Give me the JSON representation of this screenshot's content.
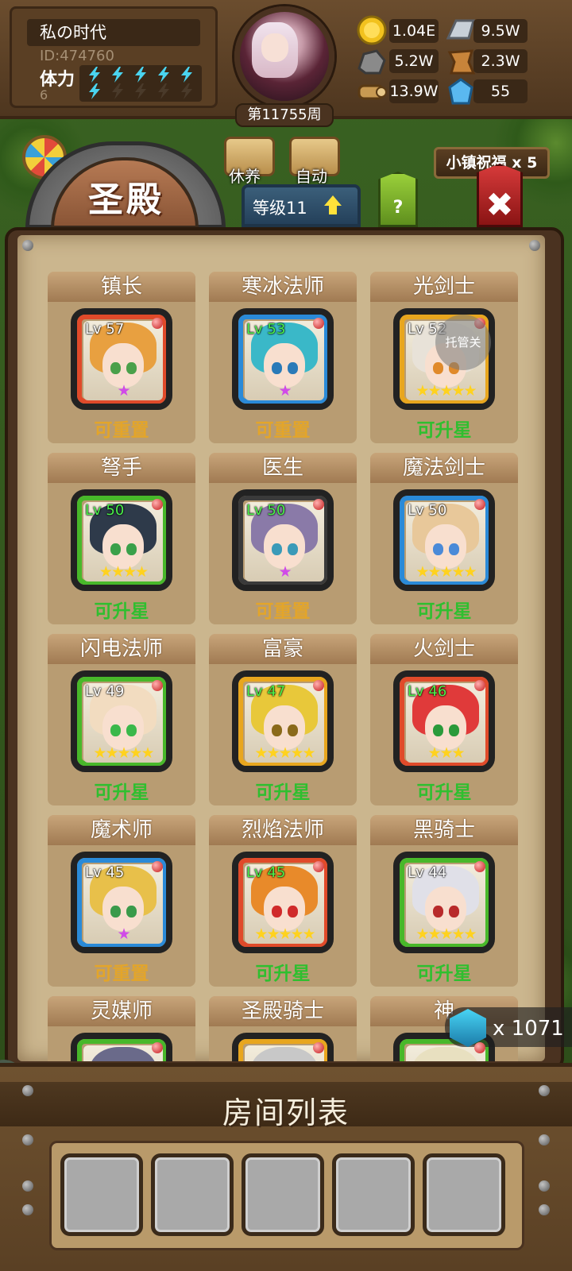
{
  "player": {
    "name": "私の时代",
    "id": "ID:474760",
    "stamina_label": "体力",
    "stamina_value": "6",
    "week": "第11755周"
  },
  "resources": [
    {
      "icon": "gold-coin-icon",
      "value": "1.04E"
    },
    {
      "icon": "iron-ingot-icon",
      "value": "9.5W"
    },
    {
      "icon": "stone-ore-icon",
      "value": "5.2W"
    },
    {
      "icon": "leather-icon",
      "value": "2.3W"
    },
    {
      "icon": "wood-log-icon",
      "value": "13.9W"
    },
    {
      "icon": "blue-crystal-icon",
      "value": "55"
    }
  ],
  "top_buttons": {
    "rest": "休养",
    "auto": "自动",
    "blessing": "小镇祝福 x 5",
    "help": "?",
    "close": "✖"
  },
  "title": "圣殿",
  "level_tab": "等级11",
  "watermark": "托管关",
  "heroes": [
    {
      "name": "镇长",
      "level": "Lv 57",
      "stars": "★",
      "star_color": "#d04ae8",
      "status": "可重置",
      "status_type": "reset",
      "frame": "#e04a2a",
      "hair": "#e8a040",
      "eye": "#4aa04a",
      "lv_color": "#ffffff"
    },
    {
      "name": "寒冰法师",
      "level": "Lv 53",
      "stars": "★",
      "star_color": "#d04ae8",
      "status": "可重置",
      "status_type": "reset",
      "frame": "#2a8ad8",
      "hair": "#3ab8c8",
      "eye": "#2a7ab8",
      "lv_color": "#4af04a"
    },
    {
      "name": "光剑士",
      "level": "Lv 52",
      "stars": "★★★★★",
      "star_color": "#ffd21e",
      "status": "可升星",
      "status_type": "up",
      "frame": "#e8a61e",
      "hair": "#e8e2d8",
      "eye": "#e08a2a",
      "lv_color": "#ffffff"
    },
    {
      "name": "弩手",
      "level": "Lv 50",
      "stars": "★★★★",
      "star_color": "#ffd21e",
      "status": "可升星",
      "status_type": "up",
      "frame": "#48b82a",
      "hair": "#2e3a4a",
      "eye": "#3aa04a",
      "lv_color": "#4af04a"
    },
    {
      "name": "医生",
      "level": "Lv 50",
      "stars": "★",
      "star_color": "#d04ae8",
      "status": "可重置",
      "status_type": "reset",
      "frame": "#3a3a3a",
      "hair": "#8a7aa8",
      "eye": "#3a9ab8",
      "lv_color": "#4af04a"
    },
    {
      "name": "魔法剑士",
      "level": "Lv 50",
      "stars": "★★★★★",
      "star_color": "#ffd21e",
      "status": "可升星",
      "status_type": "up",
      "frame": "#2a8ad8",
      "hair": "#e8c89a",
      "eye": "#4a8ad8",
      "lv_color": "#ffffff"
    },
    {
      "name": "闪电法师",
      "level": "Lv 49",
      "stars": "★★★★★",
      "star_color": "#ffd21e",
      "status": "可升星",
      "status_type": "up",
      "frame": "#48b82a",
      "hair": "#f2dcc0",
      "eye": "#3ab84a",
      "lv_color": "#ffffff"
    },
    {
      "name": "富豪",
      "level": "Lv 47",
      "stars": "★★★★★",
      "star_color": "#ffd21e",
      "status": "可升星",
      "status_type": "up",
      "frame": "#e8a61e",
      "hair": "#e8c83a",
      "eye": "#8a6a1a",
      "lv_color": "#4af04a"
    },
    {
      "name": "火剑士",
      "level": "Lv 46",
      "stars": "★★★",
      "star_color": "#ffd21e",
      "status": "可升星",
      "status_type": "up",
      "frame": "#e04a2a",
      "hair": "#e03a3a",
      "eye": "#2a9a3a",
      "lv_color": "#4af04a"
    },
    {
      "name": "魔术师",
      "level": "Lv 45",
      "stars": "★",
      "star_color": "#d04ae8",
      "status": "可重置",
      "status_type": "reset",
      "frame": "#2a8ad8",
      "hair": "#e8c04a",
      "eye": "#3a9a4a",
      "lv_color": "#ffffff"
    },
    {
      "name": "烈焰法师",
      "level": "Lv 45",
      "stars": "★★★★★",
      "star_color": "#ffd21e",
      "status": "可升星",
      "status_type": "up",
      "frame": "#e04a2a",
      "hair": "#e88a2a",
      "eye": "#d02a2a",
      "lv_color": "#4af04a"
    },
    {
      "name": "黑骑士",
      "level": "Lv 44",
      "stars": "★★★★★",
      "star_color": "#ffd21e",
      "status": "可升星",
      "status_type": "up",
      "frame": "#48b82a",
      "hair": "#e0e0e8",
      "eye": "#b82a2a",
      "lv_color": "#ffffff"
    },
    {
      "name": "灵媒师",
      "level": "",
      "stars": "",
      "star_color": "#ffd21e",
      "status": "",
      "status_type": "up",
      "frame": "#48b82a",
      "hair": "#6a6a8a",
      "eye": "#3a9a4a",
      "lv_color": "#4af04a"
    },
    {
      "name": "圣殿骑士",
      "level": "",
      "stars": "",
      "star_color": "#ffd21e",
      "status": "",
      "status_type": "up",
      "frame": "#e8a61e",
      "hair": "#c8c8c8",
      "eye": "#3a6ab8",
      "lv_color": "#4af04a"
    },
    {
      "name": "神",
      "level": "",
      "stars": "",
      "star_color": "#ffd21e",
      "status": "",
      "status_type": "up",
      "frame": "#48b82a",
      "hair": "#e8e0c0",
      "eye": "#3a9a4a",
      "lv_color": "#4af04a"
    }
  ],
  "token": {
    "icon": "eye-token-icon",
    "count": "x 1071"
  },
  "side_tab": "ap",
  "room_list": {
    "title": "房间列表",
    "slots": [
      "",
      "",
      "",
      "",
      ""
    ]
  }
}
